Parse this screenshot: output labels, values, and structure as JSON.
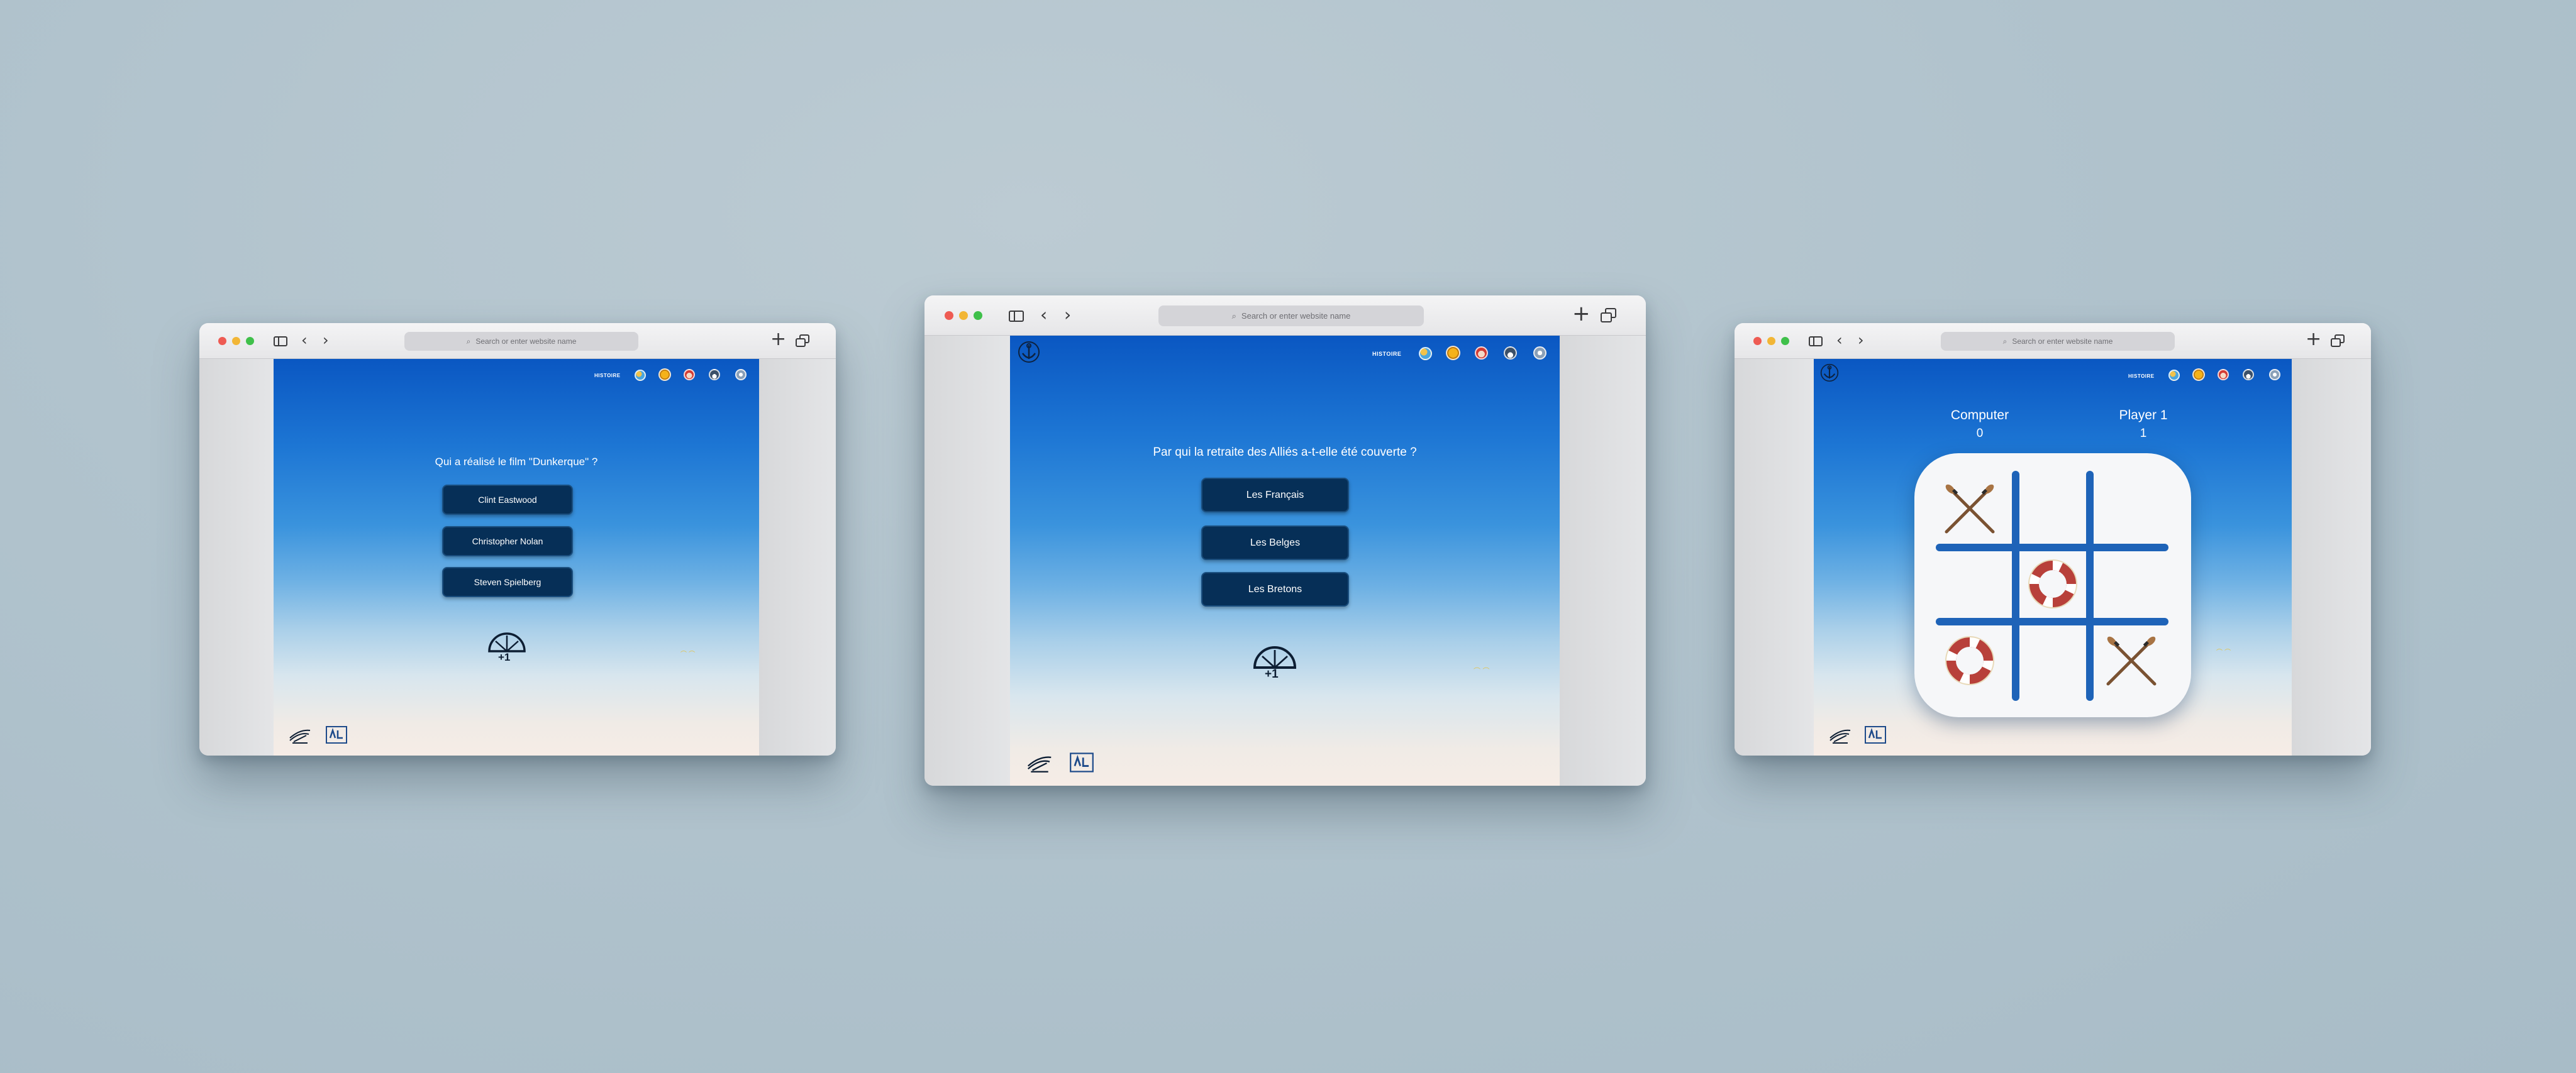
{
  "browser": {
    "url_placeholder": "Search or enter website name",
    "new_tab_icon": "plus-icon",
    "tabs_icon": "tabs-overview-icon",
    "back_icon": "chevron-left-icon",
    "forward_icon": "chevron-right-icon"
  },
  "nav": {
    "history_label": "HISTOIRE",
    "icons": [
      "globe-icon",
      "medal-icon",
      "santa-icon",
      "helmet-icon",
      "profile-icon"
    ]
  },
  "quiz_left": {
    "question": "Qui a réalisé le film \"Dunkerque\" ?",
    "answers": [
      "Clint Eastwood",
      "Christopher Nolan",
      "Steven Spielberg"
    ],
    "score_badge": "+1"
  },
  "quiz_center": {
    "question": "Par qui la retraite des Alliés a-t-elle été couverte ?",
    "answers": [
      "Les Français",
      "Les Belges",
      "Les Bretons"
    ],
    "score_badge": "+1"
  },
  "tictactoe": {
    "computer_label": "Computer",
    "computer_score": "0",
    "player_label": "Player 1",
    "player_score": "1",
    "cells": [
      "oars",
      "",
      "",
      "",
      "lifebuoy",
      "",
      "lifebuoy",
      "",
      "oars"
    ]
  },
  "colors": {
    "answer_bg": "#062f57",
    "board_line": "#1e63b8",
    "lifebuoy": "#b8403a"
  }
}
